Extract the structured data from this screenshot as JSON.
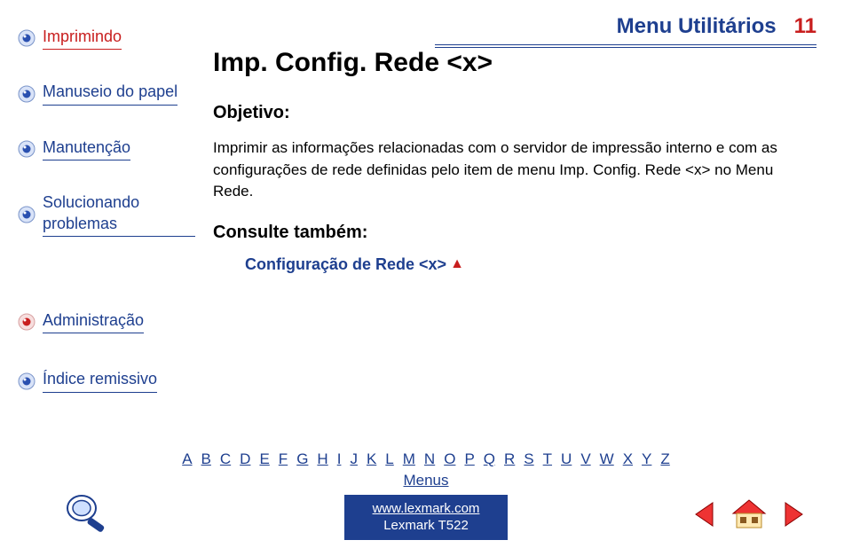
{
  "header": {
    "section": "Menu Utilitários",
    "page_number": "11"
  },
  "sidebar": {
    "items": [
      {
        "label": "Imprimindo",
        "color": "red"
      },
      {
        "label": "Manuseio do papel",
        "color": "blue"
      },
      {
        "label": "Manutenção",
        "color": "blue"
      },
      {
        "label": "Solucionando problemas",
        "color": "blue"
      }
    ],
    "admin_items": [
      {
        "label": "Administração",
        "color": "blue"
      },
      {
        "label": "Índice remissivo",
        "color": "blue"
      }
    ]
  },
  "main": {
    "title": "Imp. Config. Rede <x>",
    "objective_label": "Objetivo:",
    "body": "Imprimir as informações relacionadas com o servidor de impressão interno e com as configurações de rede definidas pelo item de menu Imp. Config. Rede  <x> no Menu Rede.",
    "see_also_label": "Consulte também:",
    "see_also_link": "Configuração de Rede  <x>"
  },
  "footer": {
    "letters": [
      "A",
      "B",
      "C",
      "D",
      "E",
      "F",
      "G",
      "H",
      "I",
      "J",
      "K",
      "L",
      "M",
      "N",
      "O",
      "P",
      "Q",
      "R",
      "S",
      "T",
      "U",
      "V",
      "W",
      "X",
      "Y",
      "Z"
    ],
    "menus_label": "Menus",
    "url": "www.lexmark.com",
    "product": "Lexmark T522"
  }
}
